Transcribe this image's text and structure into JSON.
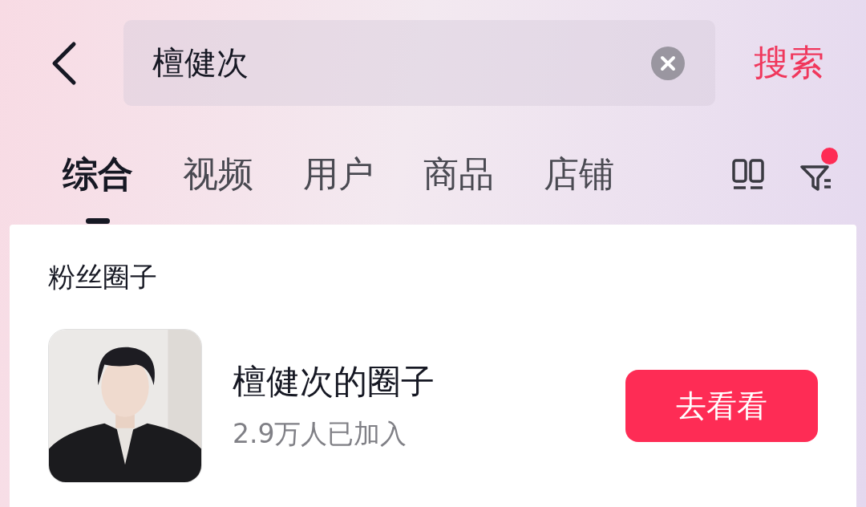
{
  "search": {
    "value": "檀健次",
    "submit": "搜索"
  },
  "tabs": [
    {
      "label": "综合",
      "selected": true
    },
    {
      "label": "视频",
      "selected": false
    },
    {
      "label": "用户",
      "selected": false
    },
    {
      "label": "商品",
      "selected": false
    },
    {
      "label": "店铺",
      "selected": false
    }
  ],
  "filter_badge": true,
  "section": {
    "title": "粉丝圈子",
    "items": [
      {
        "name": "檀健次的圈子",
        "members": "2.9万人已加入",
        "action": "去看看"
      }
    ]
  }
}
